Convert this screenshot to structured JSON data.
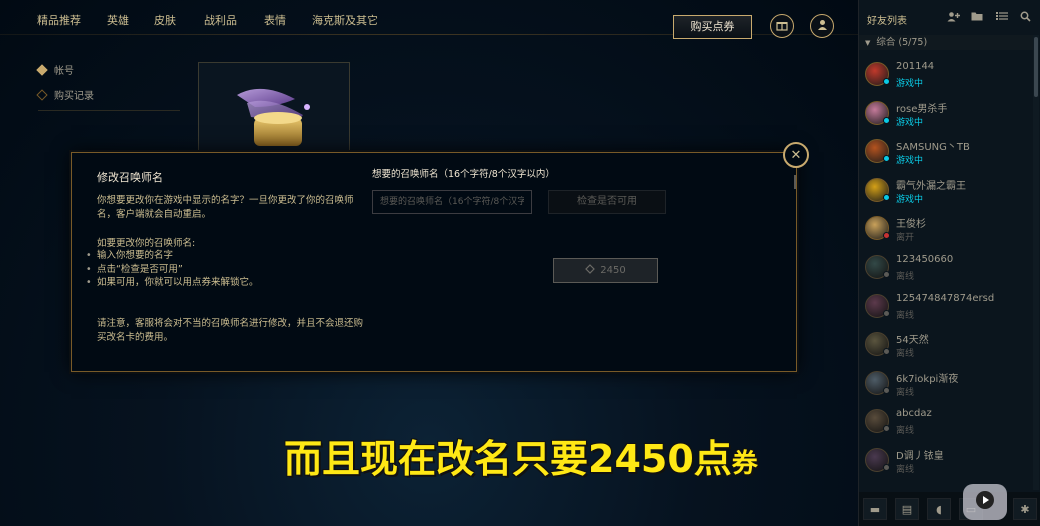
{
  "nav": {
    "items": [
      "精品推荐",
      "英雄",
      "皮肤",
      "战利品",
      "表情",
      "海克斯及其它"
    ],
    "buy_rp": "购买点券"
  },
  "sidebar": {
    "items": [
      {
        "label": "帐号",
        "active": true
      },
      {
        "label": "购买记录",
        "active": false
      }
    ]
  },
  "modal": {
    "title": "修改召唤师名",
    "desc": "你想要更改你在游戏中显示的名字？一旦你更改了你的召唤师名，客户端就会自动重启。",
    "steps_title": "如要更改你的召唤师名:",
    "steps": [
      "输入你想要的名字",
      "点击“检查是否可用”",
      "如果可用，你就可以用点券来解锁它。"
    ],
    "note": "请注意，客服将会对不当的召唤师名进行修改，并且不会退还购买改名卡的费用。",
    "field_label": "想要的召唤师名（16个字符/8个汉字以内）",
    "input_placeholder": "想要的召唤师名（16个字符/8个汉字以内）",
    "input_value": "",
    "check_button": "检查是否可用",
    "price": "2450"
  },
  "caption": {
    "main": "而且现在改名只要2450点",
    "tail": "券"
  },
  "friends": {
    "title": "好友列表",
    "group": "综合 (5/75)",
    "list": [
      {
        "name": "201144",
        "status": "游戏中",
        "online": "ingame",
        "avatar_color": "#c0392b"
      },
      {
        "name": "rose男杀手",
        "status": "游戏中",
        "online": "ingame",
        "avatar_color": "#c47a9a"
      },
      {
        "name": "SAMSUNG丶TB",
        "status": "游戏中",
        "online": "ingame",
        "avatar_color": "#b4531f"
      },
      {
        "name": "霸气外漏之霸王",
        "status": "游戏中",
        "online": "ingame",
        "avatar_color": "#d4a017"
      },
      {
        "name": "王俊杉",
        "status": "离开",
        "online": "away",
        "avatar_color": "#c9a15a"
      },
      {
        "name": "123450660",
        "status": "离线",
        "online": "offline",
        "avatar_color": "#2f6f6a"
      },
      {
        "name": "125474847874ersd",
        "status": "离线",
        "online": "offline",
        "avatar_color": "#a9467a"
      },
      {
        "name": "54天然",
        "status": "离线",
        "online": "offline",
        "avatar_color": "#8a7a3a"
      },
      {
        "name": "6k7iokpi渐夜",
        "status": "离线",
        "online": "offline",
        "avatar_color": "#5e87a6"
      },
      {
        "name": "abcdaz",
        "status": "离线",
        "online": "offline",
        "avatar_color": "#8f6a3b"
      },
      {
        "name": "D调丿铱皇",
        "status": "离线",
        "online": "offline",
        "avatar_color": "#7a4a8a"
      }
    ]
  },
  "colors": {
    "gold": "#c8aa6e",
    "ingame": "#0acbe6",
    "away": "#c73232",
    "offline": "#5b5a56",
    "caption": "#ffe815"
  },
  "icons": {
    "friends_header": [
      "add-friend-icon",
      "folder-icon",
      "list-icon",
      "search-icon"
    ],
    "footer": [
      "chat-icon",
      "news-icon",
      "mic-icon",
      "video-icon",
      "settings-icon"
    ]
  }
}
